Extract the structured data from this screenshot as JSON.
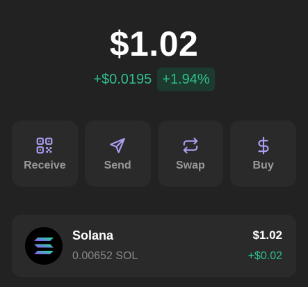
{
  "balance": {
    "total": "$1.02",
    "change_abs": "+$0.0195",
    "change_pct": "+1.94%"
  },
  "actions": [
    {
      "label": "Receive",
      "icon": "qr-code-icon"
    },
    {
      "label": "Send",
      "icon": "send-icon"
    },
    {
      "label": "Swap",
      "icon": "swap-icon"
    },
    {
      "label": "Buy",
      "icon": "dollar-icon"
    }
  ],
  "tokens": [
    {
      "name": "Solana",
      "amount": "0.00652 SOL",
      "usd_value": "$1.02",
      "usd_change": "+$0.02",
      "icon": "solana-logo-icon"
    }
  ],
  "colors": {
    "background": "#222222",
    "card": "#2a2a2a",
    "accent": "#ab9ff2",
    "positive": "#2ec08b",
    "positive_bg": "#1d3a2e",
    "muted": "#999999"
  }
}
